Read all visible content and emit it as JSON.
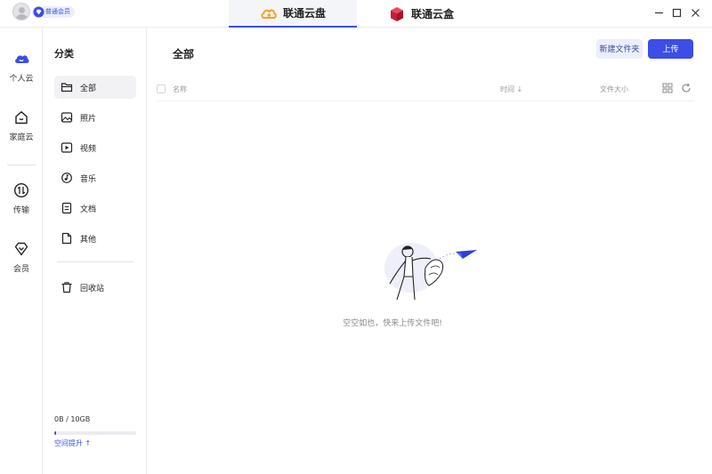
{
  "titlebar": {
    "member_badge": "普通会员",
    "tabs": [
      {
        "label": "联通云盘",
        "active": true
      },
      {
        "label": "联通云盒",
        "active": false
      }
    ]
  },
  "rail": {
    "items": [
      {
        "label": "个人云",
        "icon": "cloud-icon",
        "active": true
      },
      {
        "label": "家庭云",
        "icon": "home-icon",
        "active": false
      },
      {
        "label": "传输",
        "icon": "transfer-icon",
        "active": false
      },
      {
        "label": "会员",
        "icon": "vip-diamond-icon",
        "active": false
      }
    ]
  },
  "categories": {
    "title": "分类",
    "items": [
      {
        "label": "全部",
        "icon": "folder-icon",
        "active": true
      },
      {
        "label": "照片",
        "icon": "image-icon",
        "active": false
      },
      {
        "label": "视频",
        "icon": "video-icon",
        "active": false
      },
      {
        "label": "音乐",
        "icon": "music-icon",
        "active": false
      },
      {
        "label": "文档",
        "icon": "document-icon",
        "active": false
      },
      {
        "label": "其他",
        "icon": "file-icon",
        "active": false
      }
    ],
    "trash": {
      "label": "回收站",
      "icon": "trash-icon"
    },
    "storage": {
      "text": "0B / 10GB",
      "used_fraction": 0.01,
      "upgrade_label": "空间提升 ↑"
    }
  },
  "main": {
    "title": "全部",
    "new_folder_label": "新建文件夹",
    "upload_label": "上传",
    "columns": {
      "name": "名称",
      "time": "时间 ↓",
      "size": "文件大小"
    },
    "empty_text": "空空如也，快来上传文件吧!"
  },
  "colors": {
    "accent": "#3c4ee6",
    "brand_orange": "#f7a325",
    "box_red": "#d7263d"
  }
}
